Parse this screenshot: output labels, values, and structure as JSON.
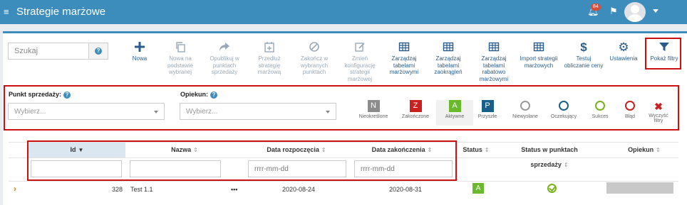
{
  "header": {
    "title": "Strategie marżowe",
    "notification_count": "84"
  },
  "search": {
    "placeholder": "Szukaj",
    "help": "?"
  },
  "toolbar": {
    "buttons": [
      {
        "label": "Nowa",
        "enabled": true,
        "icon": "plus-icon"
      },
      {
        "label": "Nowa na podstawie wybranej",
        "enabled": false,
        "icon": "copy-icon"
      },
      {
        "label": "Opublikuj w punktach sprzedaży",
        "enabled": false,
        "icon": "share-icon"
      },
      {
        "label": "Przedłuż strategię marżową",
        "enabled": false,
        "icon": "calendar-plus-icon"
      },
      {
        "label": "Zakończ w wybranych punktach",
        "enabled": false,
        "icon": "ban-icon"
      },
      {
        "label": "Zmień konfigurację strategii marżowej",
        "enabled": false,
        "icon": "edit-icon"
      },
      {
        "label": "Zarządzaj tabelami marżowymi",
        "enabled": true,
        "icon": "table-icon"
      },
      {
        "label": "Zarządzaj tabelami zaokrągleń",
        "enabled": true,
        "icon": "table-icon"
      },
      {
        "label": "Zarządzaj tabelami rabatowo marżowymi",
        "enabled": true,
        "icon": "table-icon"
      },
      {
        "label": "Import strategii marżowych",
        "enabled": true,
        "icon": "import-icon"
      },
      {
        "label": "Testuj obliczanie ceny",
        "enabled": true,
        "icon": "dollar-icon"
      },
      {
        "label": "Ustawienia",
        "enabled": true,
        "icon": "gear-icon"
      },
      {
        "label": "Pokaż filtry",
        "enabled": true,
        "icon": "filter-icon"
      }
    ]
  },
  "filters": {
    "point_label": "Punkt sprzedaży:",
    "point_placeholder": "Wybierz...",
    "guardian_label": "Opiekun:",
    "guardian_placeholder": "Wybierz...",
    "help": "?",
    "statuses": [
      {
        "letter": "N",
        "label": "Nieokreślone",
        "color": "#8c8c8c"
      },
      {
        "letter": "Z",
        "label": "Zakończone",
        "color": "#cc1f1f"
      },
      {
        "letter": "A",
        "label": "Aktywne",
        "color": "#6ab82c"
      },
      {
        "letter": "P",
        "label": "Przyszłe",
        "color": "#1a5f8a"
      }
    ],
    "sync_statuses": [
      {
        "label": "Niewysłane",
        "color": "#9a9a9a",
        "icon": "clock-icon"
      },
      {
        "label": "Oczekujący",
        "color": "#1a5f8a",
        "icon": "clock-icon"
      },
      {
        "label": "Sukces",
        "color": "#79b31b",
        "icon": "check-circle-icon"
      },
      {
        "label": "Błąd",
        "color": "#cc1f1f",
        "icon": "error-circle-icon"
      }
    ],
    "clear_label": "Wyczyść filtry"
  },
  "table": {
    "columns": [
      "Id",
      "Nazwa",
      "Data rozpoczęcia",
      "Data zakończenia",
      "Status",
      "Status w punktach sprzedaży",
      "Opiekun"
    ],
    "date_placeholder": "rrrr-mm-dd",
    "rows": [
      {
        "id": "328",
        "name": "Test 1.1",
        "menu": "•••",
        "start": "2020-08-24",
        "end": "2020-08-31",
        "status": "A"
      }
    ]
  }
}
